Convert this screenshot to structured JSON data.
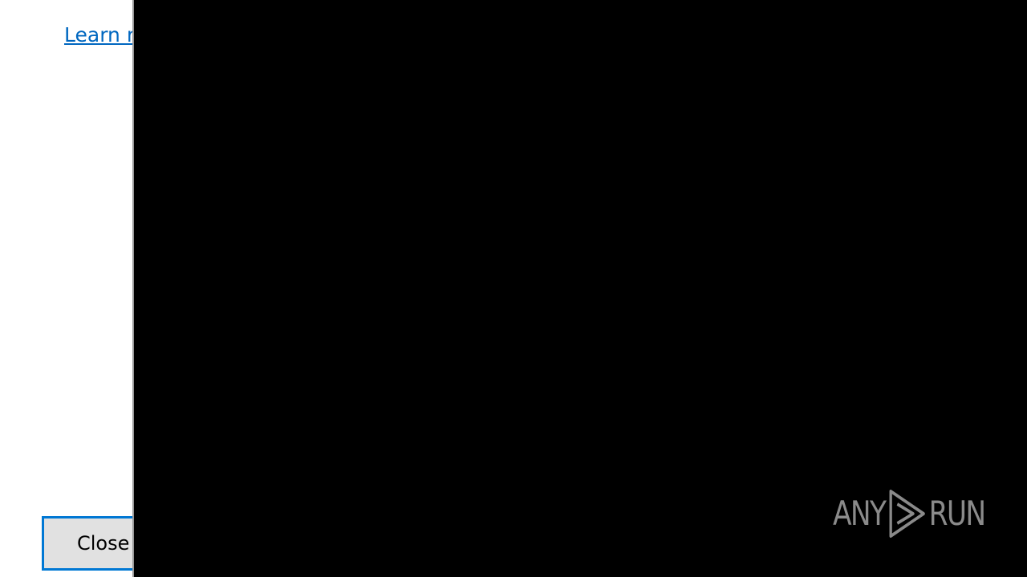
{
  "dialog": {
    "learn_link_label": "Learn more",
    "close_button_label": "Close"
  },
  "watermark": {
    "text_left": "ANY",
    "text_right": "RUN",
    "icon": "play-icon",
    "color": "#8a8a8a"
  },
  "colors": {
    "link": "#0067c0",
    "button_border": "#0078d4",
    "button_background": "#e1e1e1",
    "overlay": "#000000"
  }
}
